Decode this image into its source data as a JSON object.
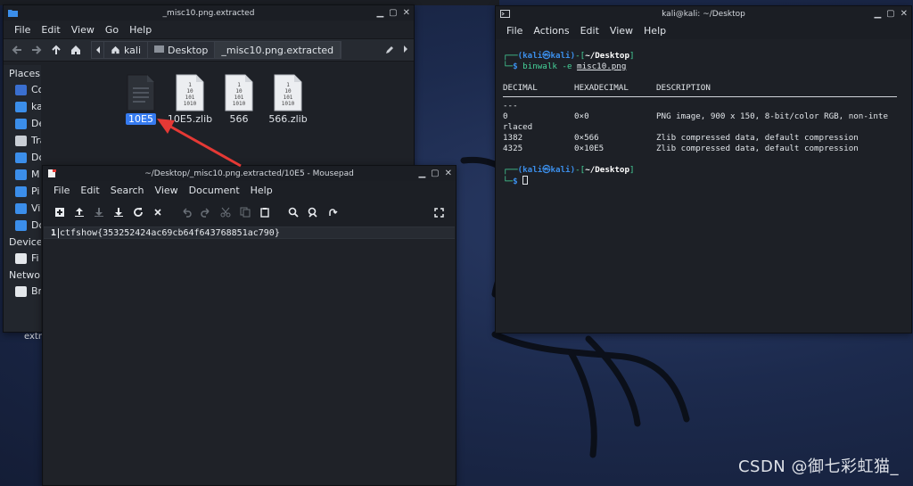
{
  "desktop": {
    "partial_label": "extra",
    "watermark": "CSDN @御七彩虹猫_"
  },
  "file_manager": {
    "title": "_misc10.png.extracted",
    "menu": [
      "File",
      "Edit",
      "View",
      "Go",
      "Help"
    ],
    "breadcrumbs": [
      "kali",
      "Desktop",
      "_misc10.png.extracted"
    ],
    "sidebar": {
      "places_header": "Places",
      "items": [
        "Computer",
        "kali",
        "Desktop",
        "Trash",
        "Documents",
        "M",
        "Pi",
        "Vi",
        "Do"
      ],
      "devices_header": "Devices",
      "devices": [
        "Fi"
      ],
      "network_header": "Networ",
      "network": [
        "Br"
      ]
    },
    "files": [
      {
        "name": "10E5",
        "selected": true,
        "type": "document"
      },
      {
        "name": "10E5.zlib",
        "selected": false,
        "type": "binary"
      },
      {
        "name": "566",
        "selected": false,
        "type": "binary"
      },
      {
        "name": "566.zlib",
        "selected": false,
        "type": "binary"
      }
    ],
    "binary_icon_text": [
      "1",
      "10",
      "101",
      "1010"
    ]
  },
  "mousepad": {
    "title": "~/Desktop/_misc10.png.extracted/10E5 - Mousepad",
    "menu": [
      "File",
      "Edit",
      "Search",
      "View",
      "Document",
      "Help"
    ],
    "line_number": "1",
    "line_text": "ctfshow{353252424ac69cb64f643768851ac790}"
  },
  "terminal": {
    "title": "kali@kali: ~/Desktop",
    "menu": [
      "File",
      "Actions",
      "Edit",
      "View",
      "Help"
    ],
    "prompt_user": "(kali㉿kali)",
    "prompt_path": "~/Desktop",
    "command": "binwalk -e",
    "command_arg": "misc10.png",
    "headers": [
      "DECIMAL",
      "HEXADECIMAL",
      "DESCRIPTION"
    ],
    "dashes": "---",
    "rows": [
      {
        "dec": "0",
        "hex": "0×0",
        "desc": "PNG image, 900 x 150, 8-bit/color RGB, non-inte"
      },
      {
        "dec": "",
        "hex": "",
        "desc": "rlaced"
      },
      {
        "dec": "1382",
        "hex": "0×566",
        "desc": "Zlib compressed data, default compression"
      },
      {
        "dec": "4325",
        "hex": "0×10E5",
        "desc": "Zlib compressed data, default compression"
      }
    ]
  },
  "colors": {
    "accent": "#367bf0",
    "terminal_blue": "#3b8eea",
    "arrow_red": "#e53935"
  }
}
